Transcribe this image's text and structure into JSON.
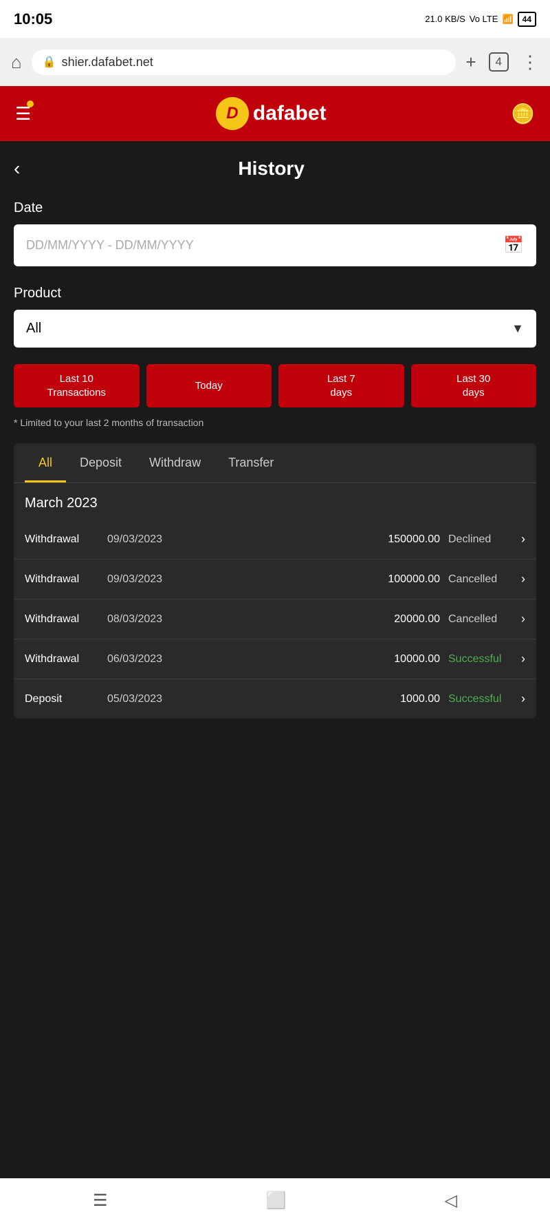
{
  "statusBar": {
    "time": "10:05",
    "networkSpeed": "21.0 KB/S",
    "volte": "Vo LTE",
    "signal": "4G",
    "battery": "44"
  },
  "browserBar": {
    "url": "shier.dafabet.net",
    "tabCount": "4"
  },
  "header": {
    "logoLetter": "D",
    "logoName": "dafabet"
  },
  "page": {
    "title": "History",
    "backLabel": "‹"
  },
  "dateFilter": {
    "label": "Date",
    "placeholder": "DD/MM/YYYY - DD/MM/YYYY"
  },
  "productFilter": {
    "label": "Product",
    "value": "All"
  },
  "filterButtons": [
    {
      "label": "Last 10\nTransactions"
    },
    {
      "label": "Today"
    },
    {
      "label": "Last 7\ndays"
    },
    {
      "label": "Last 30\ndays"
    }
  ],
  "limitNote": "* Limited to your last 2 months of transaction",
  "tabs": [
    {
      "label": "All",
      "active": true
    },
    {
      "label": "Deposit",
      "active": false
    },
    {
      "label": "Withdraw",
      "active": false
    },
    {
      "label": "Transfer",
      "active": false
    }
  ],
  "monthHeader": "March 2023",
  "transactions": [
    {
      "type": "Withdrawal",
      "date": "09/03/2023",
      "amount": "150000.00",
      "status": "Declined",
      "statusClass": "declined"
    },
    {
      "type": "Withdrawal",
      "date": "09/03/2023",
      "amount": "100000.00",
      "status": "Cancelled",
      "statusClass": "cancelled"
    },
    {
      "type": "Withdrawal",
      "date": "08/03/2023",
      "amount": "20000.00",
      "status": "Cancelled",
      "statusClass": "cancelled"
    },
    {
      "type": "Withdrawal",
      "date": "06/03/2023",
      "amount": "10000.00",
      "status": "Successful",
      "statusClass": "successful"
    },
    {
      "type": "Deposit",
      "date": "05/03/2023",
      "amount": "1000.00",
      "status": "Successful",
      "statusClass": "successful"
    }
  ]
}
